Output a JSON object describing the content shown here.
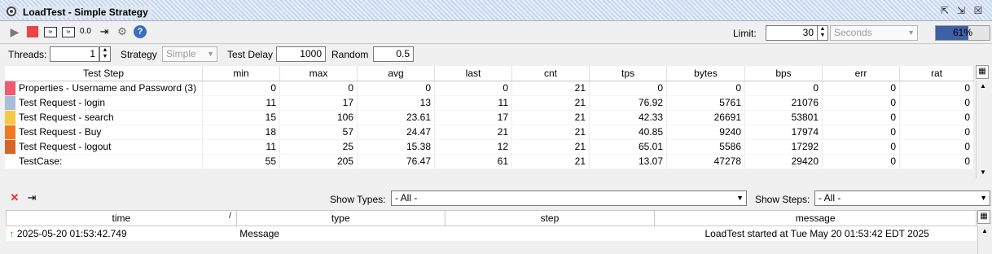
{
  "window": {
    "title": "LoadTest - Simple Strategy",
    "buttons": [
      "⇱",
      "⇲",
      "☒"
    ]
  },
  "toolbar": {
    "limit_label": "Limit:",
    "limit_value": "30",
    "limit_unit": "Seconds",
    "progress_text": "61%",
    "progress_value": 0.61,
    "graph_label": "0.0"
  },
  "options": {
    "threads_label": "Threads:",
    "threads_value": "1",
    "strategy_label": "Strategy",
    "strategy_value": "Simple",
    "test_delay_label": "Test Delay",
    "test_delay_value": "1000",
    "random_label": "Random",
    "random_value": "0.5"
  },
  "stats": {
    "columns": [
      "Test Step",
      "min",
      "max",
      "avg",
      "last",
      "cnt",
      "tps",
      "bytes",
      "bps",
      "err",
      "rat"
    ],
    "rows": [
      {
        "color": "#f05a6e",
        "name": "Properties - Username and Password (3)",
        "min": "0",
        "max": "0",
        "avg": "0",
        "last": "0",
        "cnt": "21",
        "tps": "0",
        "bytes": "0",
        "bps": "0",
        "err": "0",
        "rat": "0"
      },
      {
        "color": "#a9bcd9",
        "name": "Test Request - login",
        "min": "11",
        "max": "17",
        "avg": "13",
        "last": "11",
        "cnt": "21",
        "tps": "76.92",
        "bytes": "5761",
        "bps": "21076",
        "err": "0",
        "rat": "0"
      },
      {
        "color": "#f7c842",
        "name": "Test Request - search",
        "min": "15",
        "max": "106",
        "avg": "23.61",
        "last": "17",
        "cnt": "21",
        "tps": "42.33",
        "bytes": "26691",
        "bps": "53801",
        "err": "0",
        "rat": "0"
      },
      {
        "color": "#f07a20",
        "name": "Test Request - Buy",
        "min": "18",
        "max": "57",
        "avg": "24.47",
        "last": "21",
        "cnt": "21",
        "tps": "40.85",
        "bytes": "9240",
        "bps": "17974",
        "err": "0",
        "rat": "0"
      },
      {
        "color": "#d8642a",
        "name": "Test Request - logout",
        "min": "11",
        "max": "25",
        "avg": "15.38",
        "last": "12",
        "cnt": "21",
        "tps": "65.01",
        "bytes": "5586",
        "bps": "17292",
        "err": "0",
        "rat": "0"
      },
      {
        "color": "",
        "name": "TestCase:",
        "min": "55",
        "max": "205",
        "avg": "76.47",
        "last": "61",
        "cnt": "21",
        "tps": "13.07",
        "bytes": "47278",
        "bps": "29420",
        "err": "0",
        "rat": "0"
      }
    ]
  },
  "filters": {
    "show_types_label": "Show Types:",
    "show_types_value": "- All -",
    "show_steps_label": "Show Steps:",
    "show_steps_value": "- All -"
  },
  "log": {
    "columns": [
      "time",
      "type",
      "step",
      "message"
    ],
    "sort_indicator": "/",
    "rows": [
      {
        "time": "2025-05-20 01:53:42.749",
        "type": "Message",
        "step": "",
        "message": "LoadTest started at Tue May 20 01:53:42 EDT 2025"
      }
    ]
  }
}
